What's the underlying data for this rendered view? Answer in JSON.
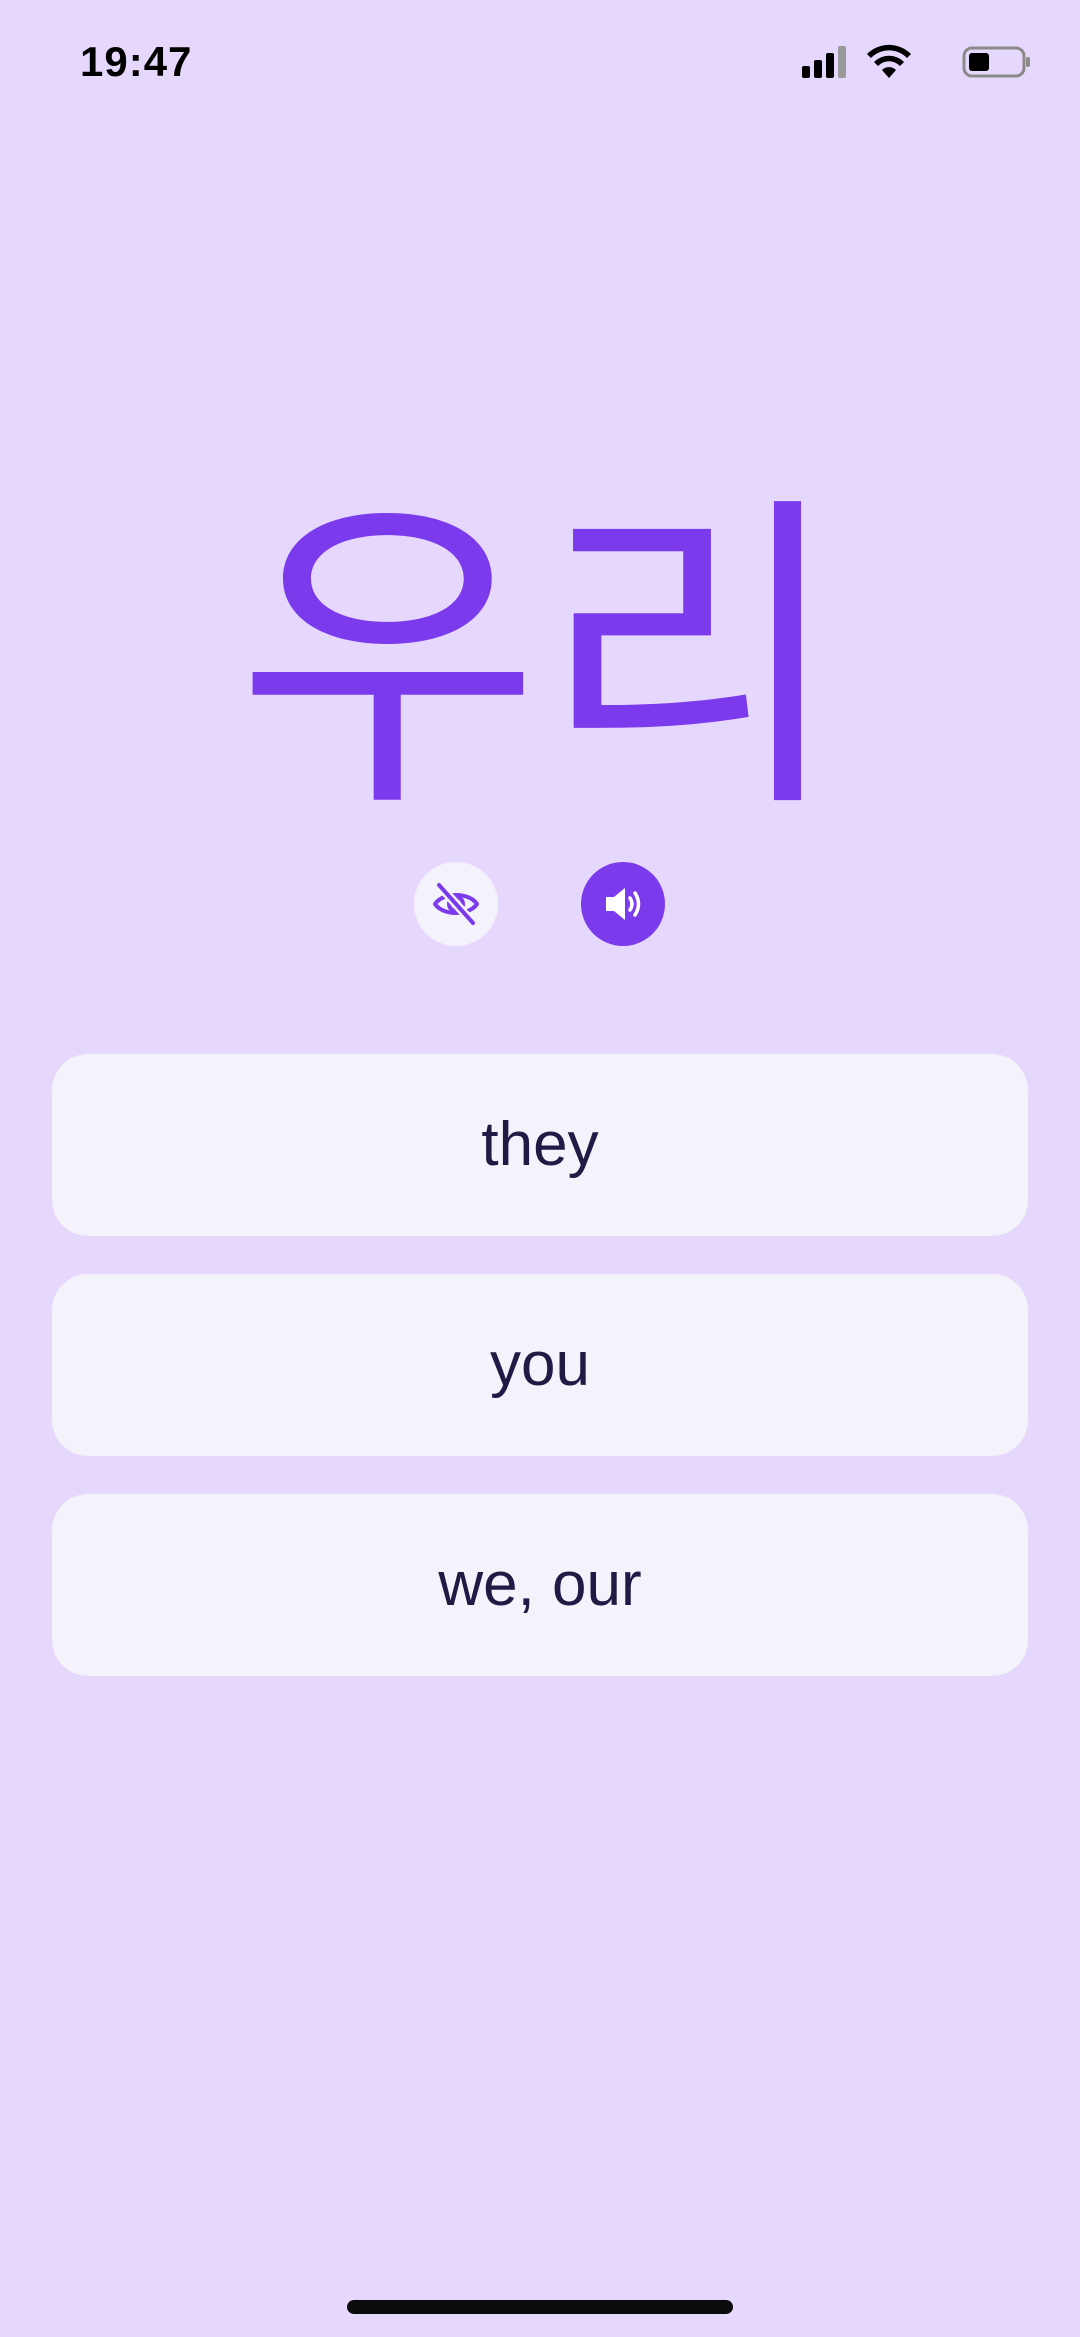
{
  "status_bar": {
    "time": "19:47"
  },
  "word": {
    "text": "우리"
  },
  "controls": {
    "hide_icon": "eye-slash-icon",
    "audio_icon": "speaker-icon"
  },
  "options": [
    {
      "label": "they"
    },
    {
      "label": "you"
    },
    {
      "label": "we, our"
    }
  ],
  "colors": {
    "background": "#E6D8FC",
    "accent": "#7C3AED",
    "card": "#F4F2FA",
    "text": "#221A45"
  }
}
